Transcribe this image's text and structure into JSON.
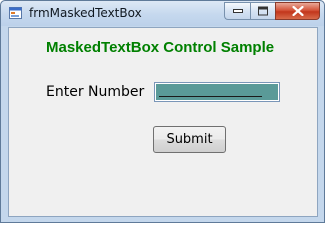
{
  "window": {
    "title": "frmMaskedTextBox",
    "controls": {
      "minimize": "minimize-icon",
      "maximize": "maximize-icon",
      "close": "close-icon"
    }
  },
  "form": {
    "heading": "MaskedTextBox Control Sample",
    "number_label": "Enter Number",
    "number_value": "",
    "submit_label": "Submit"
  },
  "colors": {
    "heading": "#008000",
    "input_fill": "#5a9a98",
    "close_button": "#c9462b"
  }
}
